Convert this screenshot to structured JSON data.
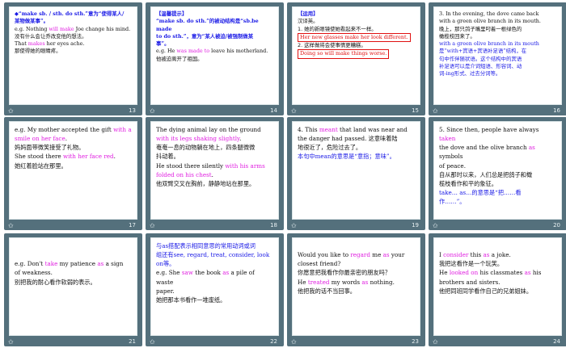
{
  "slides": [
    {
      "num": "13",
      "lines": [
        {
          "parts": [
            {
              "t": "◆“make sb. / sth. do  sth.”意为“使得某人/",
              "c": "blue bold"
            }
          ]
        },
        {
          "parts": [
            {
              "t": "某物做某事”。",
              "c": "blue bold"
            }
          ]
        },
        {
          "parts": [
            {
              "t": "e.g. Nothing ",
              "c": ""
            },
            {
              "t": "will make",
              "c": "mag"
            },
            {
              "t": " Joe change his mind.",
              "c": ""
            }
          ]
        },
        {
          "parts": [
            {
              "t": "没有什么会让乔改变他的想法。",
              "c": "cn"
            }
          ]
        },
        {
          "parts": [
            {
              "t": "That ",
              "c": ""
            },
            {
              "t": "makes",
              "c": "mag"
            },
            {
              "t": " her eyes ache.",
              "c": ""
            }
          ]
        },
        {
          "parts": [
            {
              "t": "那使得她的眼睛疼。",
              "c": "cn"
            }
          ]
        }
      ]
    },
    {
      "num": "14",
      "lines": [
        {
          "parts": [
            {
              "t": "【温馨提示】",
              "c": "blue bold"
            }
          ]
        },
        {
          "parts": [
            {
              "t": "“make sb. do  sth.”的被动结构是“sb.be made",
              "c": "blue bold"
            }
          ]
        },
        {
          "parts": [
            {
              "t": "to do  sth.”，意为“某人被迫/被强制做某",
              "c": "blue bold"
            }
          ]
        },
        {
          "parts": [
            {
              "t": "事”。",
              "c": "blue bold"
            }
          ]
        },
        {
          "parts": [
            {
              "t": "e.g. He ",
              "c": ""
            },
            {
              "t": "was made  to",
              "c": "mag"
            },
            {
              "t": " leave his motherland.",
              "c": ""
            }
          ]
        },
        {
          "parts": [
            {
              "t": "他被迫离开了祖国。",
              "c": "cn"
            }
          ]
        }
      ]
    },
    {
      "num": "15",
      "lines": [
        {
          "parts": [
            {
              "t": "【运用】",
              "c": "blue bold"
            }
          ]
        },
        {
          "parts": [
            {
              "t": "汉译英。",
              "c": "cn"
            }
          ]
        },
        {
          "parts": [
            {
              "t": "1. 她的新眼镜使她看起来不一样。",
              "c": "cn"
            }
          ]
        },
        {
          "parts": [
            {
              "t": "Her new  glasses make her look different.",
              "c": "red box"
            }
          ]
        },
        {
          "parts": [
            {
              "t": "2. 这样做将会使事情更糟糕。",
              "c": "cn"
            }
          ]
        },
        {
          "parts": [
            {
              "t": "Doing so will make things worse.",
              "c": "red box"
            }
          ]
        }
      ]
    },
    {
      "num": "16",
      "lines": [
        {
          "parts": [
            {
              "t": "3. In the evening, the dove  came back",
              "c": ""
            }
          ]
        },
        {
          "parts": [
            {
              "t": "with a green olive branch in its mouth.",
              "c": ""
            }
          ]
        },
        {
          "parts": [
            {
              "t": "晚上，那只鸽子嘴里叼着一根绿色的",
              "c": "cn"
            }
          ]
        },
        {
          "parts": [
            {
              "t": "橄榄枝回来了。",
              "c": "cn"
            }
          ]
        },
        {
          "parts": [
            {
              "t": "with a green olive branch in its mouth",
              "c": "blue"
            }
          ]
        },
        {
          "parts": [
            {
              "t": "是“with+宾语+宾语补足语”结构，在",
              "c": "blue"
            }
          ]
        },
        {
          "parts": [
            {
              "t": "句中作伴随状语。这个结构中的宾语",
              "c": "blue"
            }
          ]
        },
        {
          "parts": [
            {
              "t": "补足语可以是介词短语、形容词、动",
              "c": "blue"
            }
          ]
        },
        {
          "parts": [
            {
              "t": "词-ing形式、过去分词等。",
              "c": "blue"
            }
          ]
        }
      ]
    },
    {
      "num": "17",
      "lines": [
        {
          "parts": [
            {
              "t": "e.g. My mother accepted the gift ",
              "c": ""
            },
            {
              "t": "with a",
              "c": "mag"
            }
          ]
        },
        {
          "parts": [
            {
              "t": "smile on her face",
              "c": "mag"
            },
            {
              "t": ".",
              "c": ""
            }
          ]
        },
        {
          "parts": [
            {
              "t": "妈妈面带微笑接受了礼物。",
              "c": "cn"
            }
          ]
        },
        {
          "parts": [
            {
              "t": "She stood there ",
              "c": ""
            },
            {
              "t": "with her face red",
              "c": "mag"
            },
            {
              "t": ".",
              "c": ""
            }
          ]
        },
        {
          "parts": [
            {
              "t": "她红着脸站在那里。",
              "c": "cn"
            }
          ]
        }
      ]
    },
    {
      "num": "18",
      "lines": [
        {
          "parts": [
            {
              "t": "The dying animal  lay  on the ground",
              "c": ""
            }
          ]
        },
        {
          "parts": [
            {
              "t": "with its legs shaking slightly",
              "c": "mag"
            },
            {
              "t": ".",
              "c": ""
            }
          ]
        },
        {
          "parts": [
            {
              "t": "奄奄一息的动物躺在地上，四条腿微微",
              "c": "cn"
            }
          ]
        },
        {
          "parts": [
            {
              "t": "抖动着。",
              "c": "cn"
            }
          ]
        },
        {
          "parts": [
            {
              "t": "He stood there silently ",
              "c": ""
            },
            {
              "t": "with his arms",
              "c": "mag"
            }
          ]
        },
        {
          "parts": [
            {
              "t": "folded on his chest",
              "c": "mag"
            },
            {
              "t": ".",
              "c": ""
            }
          ]
        },
        {
          "parts": [
            {
              "t": "他双臂交叉在胸前，静静地站在那里。",
              "c": "cn"
            }
          ]
        }
      ]
    },
    {
      "num": "19",
      "lines": [
        {
          "parts": [
            {
              "t": "4. This ",
              "c": ""
            },
            {
              "t": "meant",
              "c": "mag"
            },
            {
              "t": " that land was near and",
              "c": ""
            }
          ]
        },
        {
          "parts": [
            {
              "t": "the danger had passed. 这意味着陆",
              "c": ""
            }
          ]
        },
        {
          "parts": [
            {
              "t": "地很近了，危险过去了。",
              "c": "cn"
            }
          ]
        },
        {
          "parts": [
            {
              "t": "本句中mean的意思是“意指；意味”。",
              "c": "blue"
            }
          ]
        }
      ]
    },
    {
      "num": "20",
      "lines": [
        {
          "parts": [
            {
              "t": "5. Since then, people have always ",
              "c": ""
            },
            {
              "t": "taken",
              "c": "mag"
            }
          ]
        },
        {
          "parts": [
            {
              "t": "the dove and the olive branch ",
              "c": ""
            },
            {
              "t": "as",
              "c": "mag"
            },
            {
              "t": " symbols",
              "c": ""
            }
          ]
        },
        {
          "parts": [
            {
              "t": "of peace.",
              "c": ""
            }
          ]
        },
        {
          "parts": [
            {
              "t": "自从那时以来，人们总是把鸽子和橄",
              "c": "cn"
            }
          ]
        },
        {
          "parts": [
            {
              "t": "榄枝看作和平的象征。",
              "c": "cn"
            }
          ]
        },
        {
          "parts": [
            {
              "t": "take… as…的意思是“把……看",
              "c": "blue"
            }
          ]
        },
        {
          "parts": [
            {
              "t": "作……”。",
              "c": "blue"
            }
          ]
        }
      ]
    },
    {
      "num": "21",
      "lines": [
        {
          "parts": [
            {
              "t": "",
              "c": ""
            }
          ]
        },
        {
          "parts": [
            {
              "t": "",
              "c": ""
            }
          ]
        },
        {
          "parts": [
            {
              "t": "e.g. Don't ",
              "c": ""
            },
            {
              "t": "take",
              "c": "mag"
            },
            {
              "t": " my patience ",
              "c": ""
            },
            {
              "t": "as",
              "c": "mag"
            },
            {
              "t": " a sign",
              "c": ""
            }
          ]
        },
        {
          "parts": [
            {
              "t": "of weakness.",
              "c": ""
            }
          ]
        },
        {
          "parts": [
            {
              "t": "别把我的耐心看作软弱的表示。",
              "c": "cn"
            }
          ]
        }
      ]
    },
    {
      "num": "22",
      "lines": [
        {
          "parts": [
            {
              "t": "与as搭配表示相同意思的常用动词或词",
              "c": "blue"
            }
          ]
        },
        {
          "parts": [
            {
              "t": "组还有see, regard, treat, consider, look",
              "c": "blue"
            }
          ]
        },
        {
          "parts": [
            {
              "t": "on等。",
              "c": "blue"
            }
          ]
        },
        {
          "parts": [
            {
              "t": "e.g. She ",
              "c": ""
            },
            {
              "t": "saw",
              "c": "mag"
            },
            {
              "t": " the book ",
              "c": ""
            },
            {
              "t": "as",
              "c": "mag"
            },
            {
              "t": " a pile of waste",
              "c": ""
            }
          ]
        },
        {
          "parts": [
            {
              "t": "paper.",
              "c": ""
            }
          ]
        },
        {
          "parts": [
            {
              "t": "她把那本书看作一堆废纸。",
              "c": "cn"
            }
          ]
        }
      ]
    },
    {
      "num": "23",
      "lines": [
        {
          "parts": [
            {
              "t": "",
              "c": ""
            }
          ]
        },
        {
          "parts": [
            {
              "t": "Would you like to ",
              "c": ""
            },
            {
              "t": "regard",
              "c": "mag"
            },
            {
              "t": " me ",
              "c": ""
            },
            {
              "t": "as",
              "c": "mag"
            },
            {
              "t": " your",
              "c": ""
            }
          ]
        },
        {
          "parts": [
            {
              "t": "closest friend?",
              "c": ""
            }
          ]
        },
        {
          "parts": [
            {
              "t": "你愿意把我看作你最亲密的朋友吗？",
              "c": "cn"
            }
          ]
        },
        {
          "parts": [
            {
              "t": "He ",
              "c": ""
            },
            {
              "t": "treated",
              "c": "mag"
            },
            {
              "t": " my words ",
              "c": ""
            },
            {
              "t": "as",
              "c": "mag"
            },
            {
              "t": " nothing.",
              "c": ""
            }
          ]
        },
        {
          "parts": [
            {
              "t": "他把我的话不当回事。",
              "c": "cn"
            }
          ]
        }
      ]
    },
    {
      "num": "24",
      "lines": [
        {
          "parts": [
            {
              "t": "",
              "c": ""
            }
          ]
        },
        {
          "parts": [
            {
              "t": "I ",
              "c": ""
            },
            {
              "t": "consider",
              "c": "mag"
            },
            {
              "t": " this ",
              "c": ""
            },
            {
              "t": "as",
              "c": "mag"
            },
            {
              "t": " a joke.",
              "c": ""
            }
          ]
        },
        {
          "parts": [
            {
              "t": "我把这看作是一个玩笑。",
              "c": "cn"
            }
          ]
        },
        {
          "parts": [
            {
              "t": "He ",
              "c": ""
            },
            {
              "t": "looked on",
              "c": "mag"
            },
            {
              "t": " his classmates ",
              "c": ""
            },
            {
              "t": "as",
              "c": "mag"
            },
            {
              "t": " his",
              "c": ""
            }
          ]
        },
        {
          "parts": [
            {
              "t": "brothers and sisters.",
              "c": ""
            }
          ]
        },
        {
          "parts": [
            {
              "t": "他把同班同学看作自己的兄弟姐妹。",
              "c": "cn"
            }
          ]
        }
      ]
    }
  ],
  "star_glyph": "✩"
}
